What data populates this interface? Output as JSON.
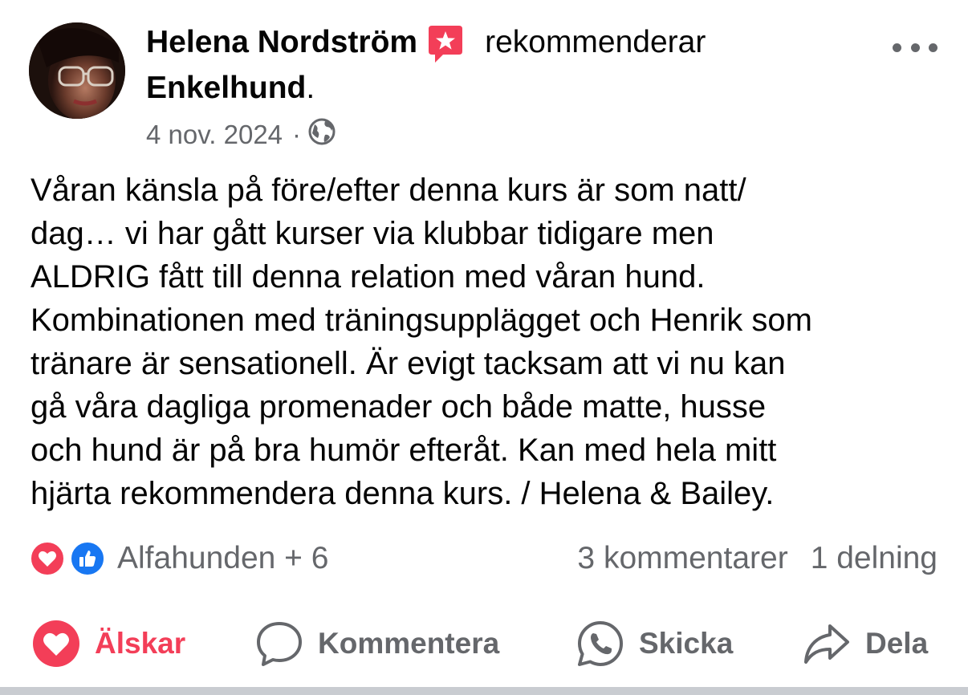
{
  "post": {
    "author": "Helena Nordström",
    "verb": "rekommenderar",
    "page_name": "Enkelhund",
    "page_suffix": ".",
    "date": "4 nov. 2024",
    "separator": "·",
    "audience_icon": "globe-icon",
    "text_lines": [
      "Våran känsla på före/efter denna kurs är som natt/",
      "dag… vi har gått kurser via klubbar tidigare men",
      "ALDRIG fått till denna relation med våran hund.",
      "Kombinationen med träningsupplägget och Henrik som",
      "tränare är sensationell. Är evigt tacksam att vi nu kan",
      "gå våra dagliga promenader och både matte, husse",
      "och hund är på bra humör efteråt. Kan med hela mitt",
      "hjärta rekommendera denna kurs. / Helena & Bailey."
    ]
  },
  "reactions": {
    "icons": [
      "love-reaction-icon",
      "like-reaction-icon"
    ],
    "summary": "Alfahunden + 6",
    "comments": "3 kommentarer",
    "shares": "1 delning"
  },
  "actions": {
    "love": "Älskar",
    "comment": "Kommentera",
    "send": "Skicka",
    "share": "Dela"
  },
  "colors": {
    "love": "#f33e58",
    "like": "#1877f2",
    "secondary_text": "#65676b",
    "primary_text": "#050505"
  }
}
